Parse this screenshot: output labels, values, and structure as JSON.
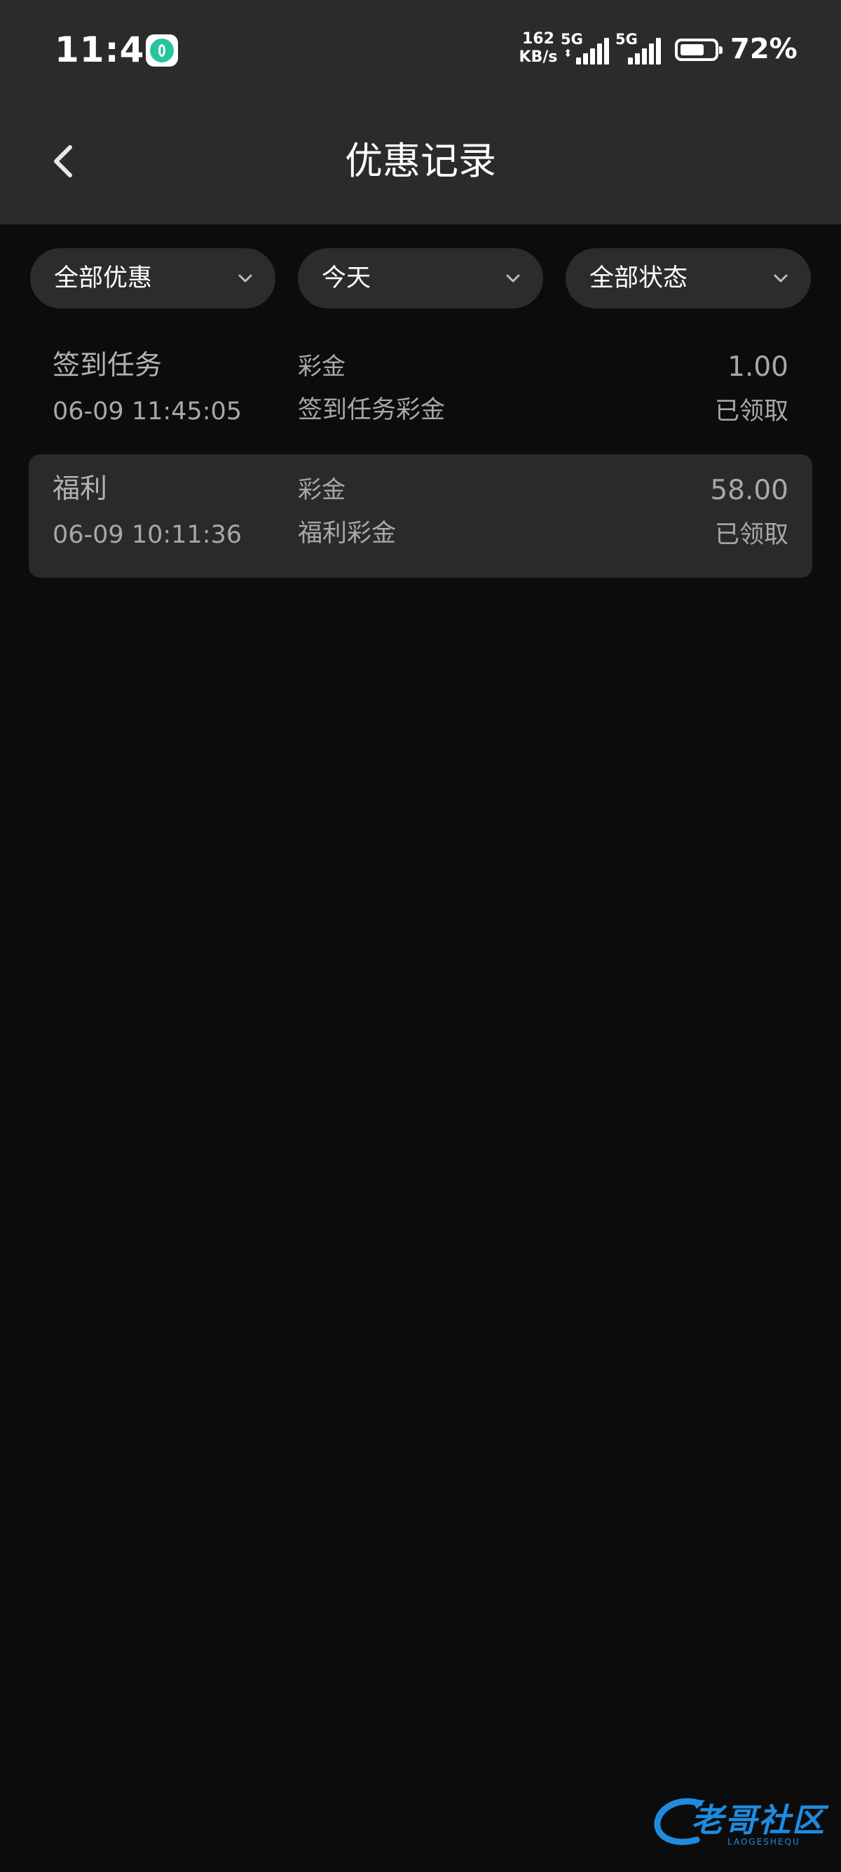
{
  "status_bar": {
    "time": "11:45",
    "net_speed_value": "162",
    "net_speed_unit": "KB/s",
    "sim1_label": "5G",
    "sim2_label": "5G",
    "battery_level": 0.72,
    "battery_text": "72%"
  },
  "header": {
    "title": "优惠记录",
    "back_icon": "chevron-left-icon"
  },
  "filters": [
    {
      "label": "全部优惠",
      "icon": "chevron-down-icon"
    },
    {
      "label": "今天",
      "icon": "chevron-down-icon"
    },
    {
      "label": "全部状态",
      "icon": "chevron-down-icon"
    }
  ],
  "records": [
    {
      "name": "签到任务",
      "time": "06-09 11:45:05",
      "type": "彩金",
      "description": "签到任务彩金",
      "amount": "1.00",
      "status": "已领取"
    },
    {
      "name": "福利",
      "time": "06-09 10:11:36",
      "type": "彩金",
      "description": "福利彩金",
      "amount": "58.00",
      "status": "已领取"
    }
  ],
  "watermark": {
    "text": "老哥社区",
    "subtext": "LAOGESHEQU"
  },
  "colors": {
    "header_bg": "#2b2b2b",
    "page_bg": "#0c0c0c",
    "pill_bg": "#2c2c2c",
    "selected_row_bg": "#2a2a2a",
    "secondary_text": "#a8a8a8",
    "watermark_blue": "#1e8be0"
  }
}
